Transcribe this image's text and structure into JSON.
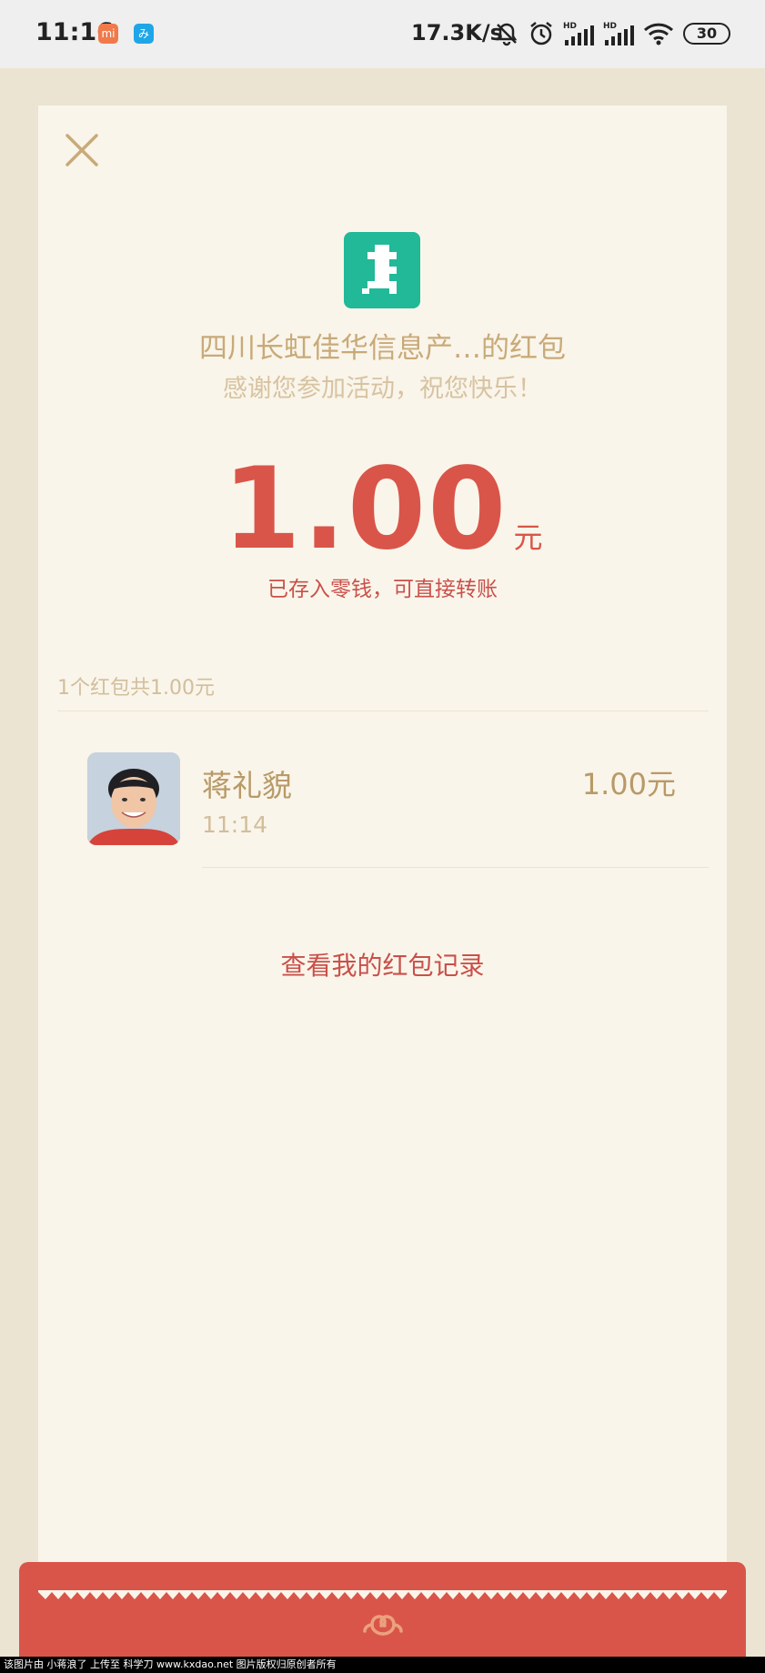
{
  "status_bar": {
    "time": "11:16",
    "app_icons": [
      "mi-store-icon",
      "app-blue-icon"
    ],
    "net_speed": "17.3K/s",
    "battery": "30",
    "signal_labels": [
      "HD",
      "HD"
    ]
  },
  "redpacket": {
    "sender_title": "四川长虹佳华信息产…的红包",
    "greeting": "感谢您参加活动，祝您快乐！",
    "amount": "1.00",
    "unit": "元",
    "note": "已存入零钱，可直接转账",
    "summary": "1个红包共1.00元"
  },
  "records": [
    {
      "name": "蒋礼貌",
      "time": "11:14",
      "amount": "1.00元"
    }
  ],
  "actions": {
    "history": "查看我的红包记录"
  },
  "watermark": "该图片由 小蒋浪了 上传至 科学刀 www.kxdao.net 图片版权归原创者所有",
  "colors": {
    "accent_red": "#d9554a",
    "gold": "#c8aa79",
    "card_bg": "#faf5ea",
    "logo_green": "#21b998"
  }
}
